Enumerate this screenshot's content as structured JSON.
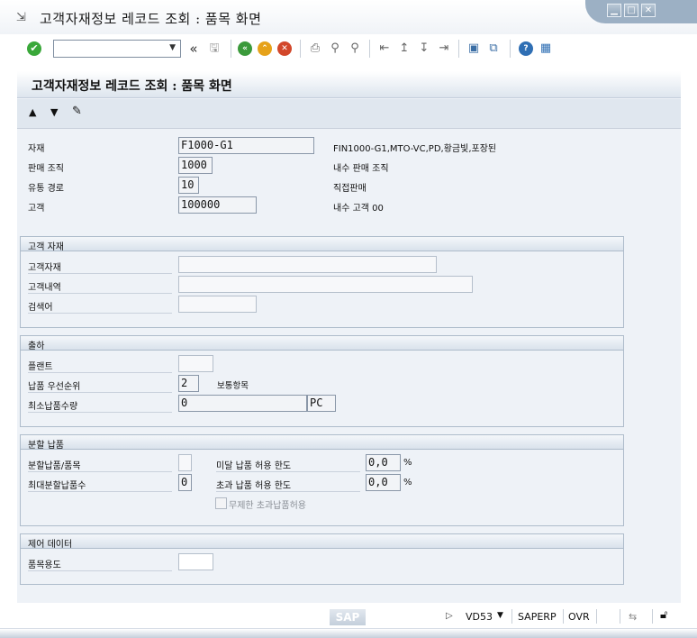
{
  "window": {
    "title": "고객자재정보 레코드 조회 : 품목 화면",
    "controls": {
      "minimize": "▁",
      "maximize": "□",
      "close": "✕"
    }
  },
  "toolbar": {
    "command_value": "",
    "collapse_symbol": "«",
    "icons": [
      "enter-icon",
      "save-icon",
      "back-icon",
      "exit-icon",
      "cancel-icon",
      "print-icon",
      "find-icon",
      "find-next-icon",
      "first-page-icon",
      "prev-page-icon",
      "next-page-icon",
      "last-page-icon",
      "new-session-icon",
      "shortcut-icon",
      "help-icon",
      "layout-icon"
    ]
  },
  "screen": {
    "title": "고객자재정보 레코드 조회 : 품목 화면"
  },
  "header_fields": {
    "material": {
      "label": "자재",
      "value": "F1000-G1",
      "desc": "FIN1000-G1,MTO-VC,PD,황금빛,포장된"
    },
    "sales_org": {
      "label": "판매 조직",
      "value": "1000",
      "desc": "내수 판매 조직"
    },
    "dist_channel": {
      "label": "유통 경로",
      "value": "10",
      "desc": "직접판매"
    },
    "customer": {
      "label": "고객",
      "value": "100000",
      "desc": "내수 고객 00"
    }
  },
  "customer_material": {
    "title": "고객 자재",
    "cust_material": {
      "label": "고객자재",
      "value": ""
    },
    "cust_desc": {
      "label": "고객내역",
      "value": ""
    },
    "search_term": {
      "label": "검색어",
      "value": ""
    }
  },
  "shipping": {
    "title": "출하",
    "plant": {
      "label": "플랜트",
      "value": ""
    },
    "delivery_priority": {
      "label": "납품 우선순위",
      "value": "2",
      "desc": "보통항목"
    },
    "min_qty": {
      "label": "최소납품수량",
      "value": "0",
      "unit": "PC"
    }
  },
  "partial": {
    "title": "분할 납품",
    "partial_item": {
      "label": "분할납품/품목",
      "value": ""
    },
    "max_partial": {
      "label": "최대분할납품수",
      "value": "0"
    },
    "under_tol": {
      "label": "미달 납품 허용 한도",
      "value": "0,0",
      "unit": "%"
    },
    "over_tol": {
      "label": "초과 납품 허용 한도",
      "value": "0,0",
      "unit": "%"
    },
    "unlimited": {
      "label": "무제한 초과납품허용",
      "checked": false
    }
  },
  "control": {
    "title": "제어 데이터",
    "item_usage": {
      "label": "품목용도",
      "value": ""
    }
  },
  "status": {
    "sap_logo": "SAP",
    "transaction": "VD53",
    "system": "SAPERP",
    "mode": "OVR"
  }
}
